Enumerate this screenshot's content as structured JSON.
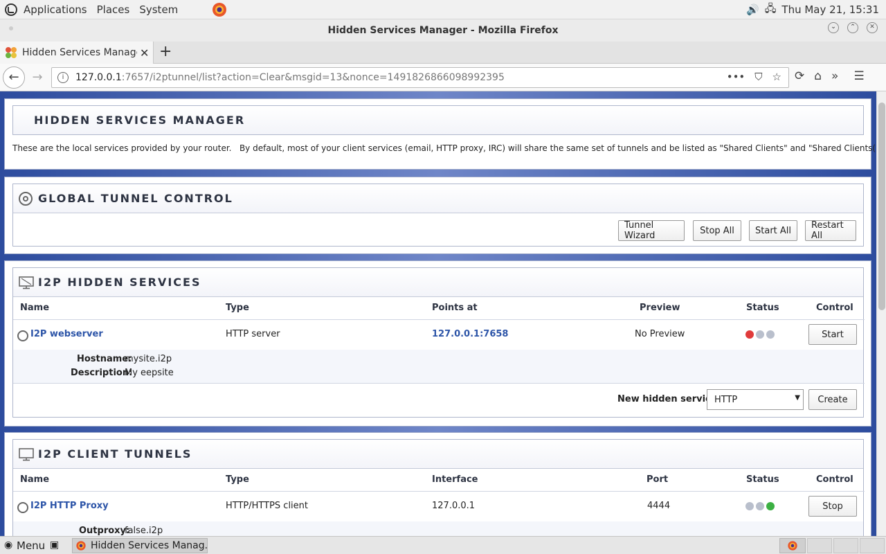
{
  "system": {
    "menus": [
      "Applications",
      "Places",
      "System"
    ],
    "clock": "Thu May 21, 15:31"
  },
  "window": {
    "title": "Hidden Services Manager - Mozilla Firefox"
  },
  "tab": {
    "title": "Hidden Services Manage"
  },
  "url": {
    "host": "127.0.0.1",
    "rest": ":7657/i2ptunnel/list?action=Clear&msgid=13&nonce=1491826866098992395"
  },
  "header": {
    "title": "HIDDEN SERVICES MANAGER",
    "description": "These are the local services provided by your router.   By default, most of your client services (email, HTTP proxy, IRC) will share the same set of tunnels and be listed as \"Shared Clients\" and \"Shared Clients(DSA)\"."
  },
  "global": {
    "title": "GLOBAL TUNNEL CONTROL",
    "buttons": [
      "Tunnel Wizard",
      "Stop All",
      "Start All",
      "Restart All"
    ]
  },
  "hidden": {
    "title": "I2P HIDDEN SERVICES",
    "columns": [
      "Name",
      "Type",
      "Points at",
      "Preview",
      "Status",
      "Control"
    ],
    "rows": [
      {
        "name": "I2P webserver",
        "type": "HTTP server",
        "points_at": "127.0.0.1:7658",
        "preview": "No Preview",
        "control": "Start",
        "hostname_label": "Hostname:",
        "hostname": "mysite.i2p",
        "description_label": "Description:",
        "description": "My eepsite"
      }
    ],
    "new_label": "New hidden service:",
    "new_select": "HTTP",
    "create": "Create"
  },
  "clients": {
    "title": "I2P CLIENT TUNNELS",
    "columns": [
      "Name",
      "Type",
      "Interface",
      "Port",
      "Status",
      "Control"
    ],
    "rows": [
      {
        "name": "I2P HTTP Proxy",
        "type": "HTTP/HTTPS client",
        "interface": "127.0.0.1",
        "port": "4444",
        "control": "Stop",
        "outproxy_label": "Outproxy:",
        "outproxy": "false.i2p"
      }
    ]
  },
  "taskbar": {
    "menu": "Menu",
    "item": "Hidden Services Manag..."
  },
  "colors": {
    "status_red": "#e03b3b",
    "status_green": "#3cb043",
    "status_grey": "#b9bfcc",
    "link": "#2d55a8",
    "background_blue": "#2d4c9e"
  },
  "icons": [
    "mint-logo-icon",
    "firefox-icon",
    "volume-icon",
    "network-icon",
    "gear-icon",
    "screen-icon"
  ]
}
